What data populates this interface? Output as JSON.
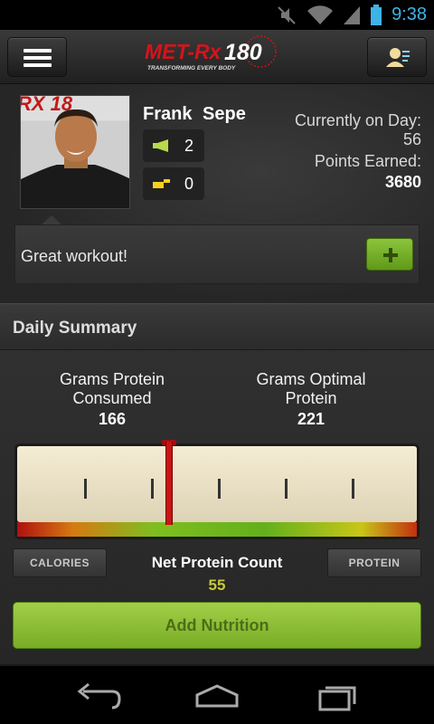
{
  "status_bar": {
    "time": "9:38",
    "icons": [
      "mute-icon",
      "wifi-icon",
      "battery-icon"
    ]
  },
  "action_bar": {
    "logo_brand": "MET-Rx",
    "logo_number": "180",
    "logo_tagline": "TRANSFORMING EVERY BODY",
    "icons": {
      "menu": "hamburger-menu-icon",
      "profile": "profile-card-icon"
    }
  },
  "profile": {
    "first_name": "Frank",
    "last_name": "Sepe",
    "full_name": "Frank  Sepe",
    "likes": "2",
    "dislikes": "0",
    "day_label": "Currently on Day:",
    "day_value": "56",
    "points_label": "Points Earned:",
    "points_value": "3680",
    "photo_banner_text": "RX 18"
  },
  "comment": {
    "text": "Great workout!",
    "add_button": "+"
  },
  "summary": {
    "title": "Daily Summary",
    "consumed_label_1": "Grams Protein",
    "consumed_label_2": "Consumed",
    "consumed_value": "166",
    "optimal_label_1": "Grams Optimal",
    "optimal_label_2": "Protein",
    "optimal_value": "221",
    "gauge_level": 0.38,
    "calories_button": "CALORIES",
    "protein_button": "PROTEIN",
    "net_title": "Net Protein Count",
    "net_value": "55",
    "add_nutrition_button": "Add Nutrition"
  },
  "colors": {
    "accent_green": "#8cc43c",
    "status_blue": "#3fb3e6",
    "needle_red": "#c81414",
    "net_value_yellow": "#c8c83a"
  },
  "nav": {
    "icons": [
      "back-icon",
      "home-icon",
      "recent-apps-icon"
    ]
  }
}
